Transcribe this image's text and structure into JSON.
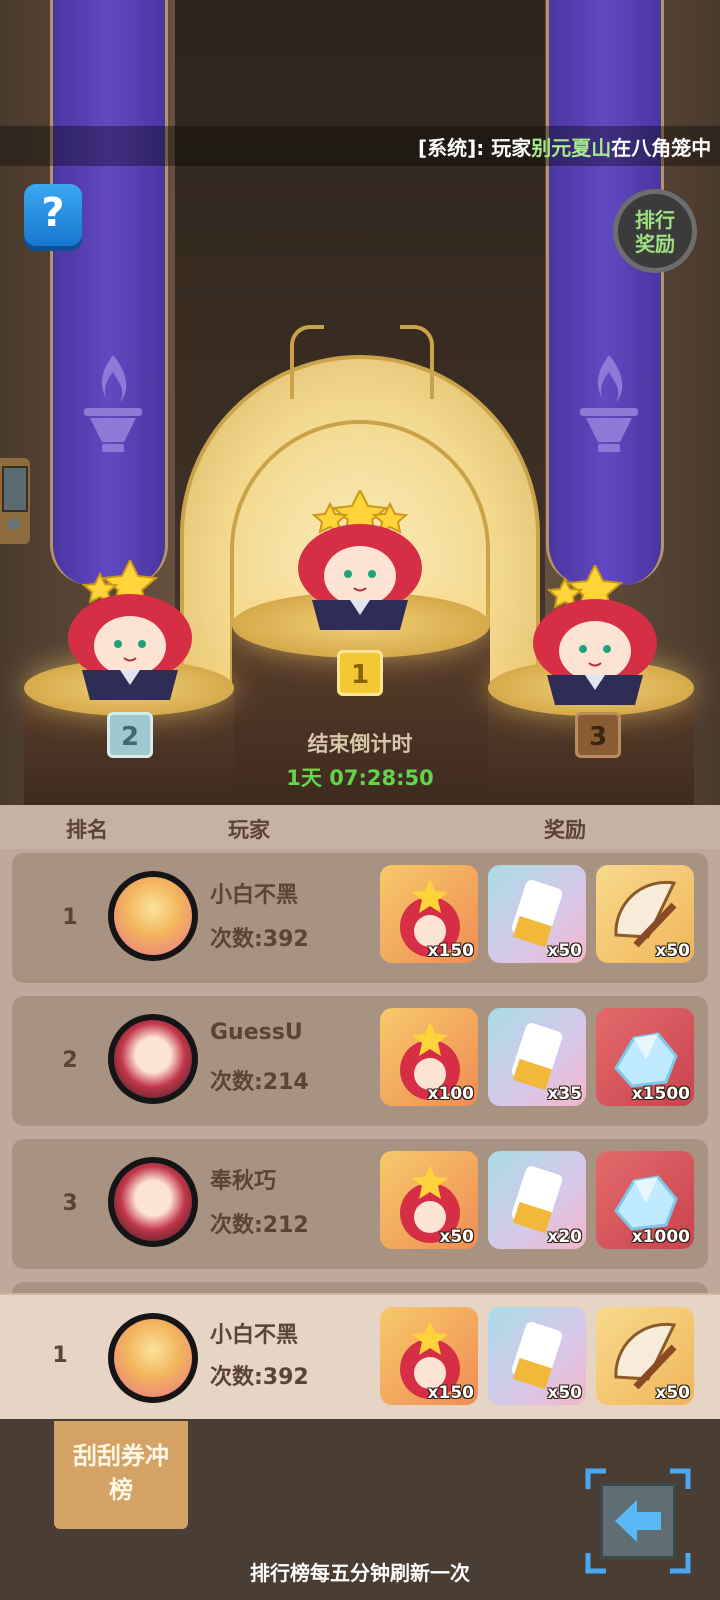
{
  "ticker": {
    "prefix": "[系统]: 玩家",
    "highlight": "别元夏山",
    "suffix": "在八角笼中"
  },
  "buttons": {
    "help": "?",
    "rank_reward_line1": "排行",
    "rank_reward_line2": "奖励"
  },
  "podium": {
    "rank1": "1",
    "rank2": "2",
    "rank3": "3"
  },
  "countdown": {
    "label": "结束倒计时",
    "value": "1天 07:28:50"
  },
  "board": {
    "headers": {
      "rank": "排名",
      "player": "玩家",
      "reward": "奖励"
    },
    "rows": [
      {
        "rank": "1",
        "name": "小白不黑",
        "count": "次数:392",
        "rewards": [
          {
            "type": "card",
            "qty": "x150"
          },
          {
            "type": "ticket",
            "qty": "x50"
          },
          {
            "type": "fan",
            "qty": "x50"
          }
        ]
      },
      {
        "rank": "2",
        "name": "GuessU",
        "count": "次数:214",
        "rewards": [
          {
            "type": "card",
            "qty": "x100"
          },
          {
            "type": "ticket",
            "qty": "x35"
          },
          {
            "type": "gem",
            "qty": "x1500"
          }
        ]
      },
      {
        "rank": "3",
        "name": "奉秋巧",
        "count": "次数:212",
        "rewards": [
          {
            "type": "card",
            "qty": "x50"
          },
          {
            "type": "ticket",
            "qty": "x20"
          },
          {
            "type": "gem",
            "qty": "x1000"
          }
        ]
      }
    ]
  },
  "self_row": {
    "rank": "1",
    "name": "小白不黑",
    "count": "次数:392",
    "rewards": [
      {
        "type": "card",
        "qty": "x150"
      },
      {
        "type": "ticket",
        "qty": "x50"
      },
      {
        "type": "fan",
        "qty": "x50"
      }
    ]
  },
  "footer": {
    "scratch_line1": "刮刮券冲",
    "scratch_line2": "榜",
    "refresh_note": "排行榜每五分钟刷新一次"
  },
  "icons": {
    "help": "question-icon",
    "back": "arrow-left-icon",
    "torch": "torch-icon"
  },
  "colors": {
    "highlight_green": "#a6e88c",
    "countdown_green": "#62d64a",
    "banner_purple": "#5a42b8"
  }
}
